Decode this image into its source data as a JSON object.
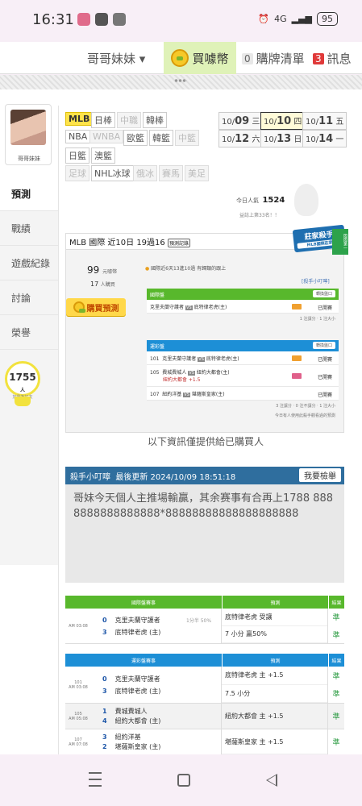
{
  "status_bar": {
    "time": "16:31",
    "network": "4G",
    "battery": "95"
  },
  "top_nav": {
    "user": "哥哥妹妹 ▾",
    "buy_label": "買噱幣",
    "cart_count": "0",
    "cart_label": "購牌清單",
    "msg_count": "3",
    "msg_label": "訊息"
  },
  "profile": {
    "name": "哥哥妹妹"
  },
  "sidebar": {
    "items": [
      {
        "label": "預測"
      },
      {
        "label": "戰績"
      },
      {
        "label": "遊戲紀錄"
      },
      {
        "label": "討論"
      },
      {
        "label": "榮譽"
      }
    ]
  },
  "hearts": {
    "count": "1755",
    "unit": "人",
    "sub": "加我為好友"
  },
  "sports": [
    {
      "label": "MLB"
    },
    {
      "label": "日棒"
    },
    {
      "label": "中職"
    },
    {
      "label": "韓棒"
    },
    {
      "label": "NBA"
    },
    {
      "label": "WNBA"
    },
    {
      "label": "歐籃"
    },
    {
      "label": "韓籃"
    },
    {
      "label": "中籃"
    },
    {
      "label": "日籃"
    },
    {
      "label": "澳籃"
    },
    {
      "label": "足球"
    },
    {
      "label": "NHL冰球"
    },
    {
      "label": "俄冰"
    },
    {
      "label": "賽馬"
    },
    {
      "label": "美足"
    }
  ],
  "dates": [
    {
      "prefix": "10/",
      "day": "09",
      "weekday": "三"
    },
    {
      "prefix": "10/",
      "day": "10",
      "weekday": "四"
    },
    {
      "prefix": "10/",
      "day": "11",
      "weekday": "五"
    },
    {
      "prefix": "10/",
      "day": "12",
      "weekday": "六"
    },
    {
      "prefix": "10/",
      "day": "13",
      "weekday": "日"
    },
    {
      "prefix": "10/",
      "day": "14",
      "weekday": "一"
    }
  ],
  "stats": {
    "today_label": "今日人氣",
    "today_value": "1524",
    "rank": "益誌上第33名！！"
  },
  "panel": {
    "title": "MLB 國際 近10日 19過16",
    "title_badge": "預測記錄",
    "king_badge": "莊家殺手",
    "king_sub": "MLB國際莊家",
    "ribbon": "悶悶第一",
    "price": "99",
    "price_unit": "元噱幣",
    "buyers": "17",
    "buyers_unit": "人購買",
    "buy_button": "購買預測",
    "note": "國際近6天13進10過 有歸類的跟上",
    "link": "[殺手小叮嚀]",
    "international": {
      "header": "國際盤",
      "btn": "轉換盤口",
      "rows": [
        {
          "home": "克里夫蘭守護者",
          "vs": "VS",
          "away": "底特律老虎(主)",
          "status": "已開賽"
        }
      ],
      "foot": "1 注讓分 ‧ 1 注大小"
    },
    "taiwan": {
      "header": "運彩盤",
      "btn": "轉換盤口",
      "rows": [
        {
          "num": "101",
          "home": "克里夫蘭守護者",
          "vs": "VS",
          "away": "底特律老虎(主)",
          "status": "已開賽",
          "line": ""
        },
        {
          "num": "105",
          "home": "費城費城人",
          "vs": "VS",
          "away": "紐約大都會(主)",
          "status": "已開賽",
          "line": "紐約大都會 +1.5"
        },
        {
          "num": "107",
          "home": "紐約洋基",
          "vs": "VS",
          "away": "堪薩斯皇家(主)",
          "status": "已開賽",
          "line": ""
        }
      ],
      "foot": "3 注讓分 ‧ 0 注不讓分 ‧ 1 注大小",
      "foot2": "今日有人使用此殺手觀看過的預測"
    }
  },
  "info_text": "以下資訊僅提供給已購買人",
  "tip": {
    "title": "殺手小叮嚀",
    "updated": "最後更新 2024/10/09 18:51:18",
    "report_btn": "我要檢舉",
    "body": "哥妹今天個人主推場輸贏，其余赛事有合再上1788 8888888888888888*88888888888888888888"
  },
  "intl_table": {
    "headers": [
      "國際盤賽事",
      "預測",
      "結果"
    ],
    "rows": [
      {
        "time": "AM 03:08",
        "team1_num": "0",
        "team1": "克里夫蘭守護者",
        "team2_num": "3",
        "team2": "底特律老虎 (主)",
        "spread": "1分半 50%",
        "pred1": "底特律老虎 受讓",
        "pred2": "7 小分 贏50%",
        "res1": "準",
        "res2": "準"
      }
    ]
  },
  "tw_table": {
    "headers": [
      "運彩盤賽事",
      "預測",
      "結果"
    ],
    "rows": [
      {
        "num": "101",
        "time": "AM 03:08",
        "team1_num": "0",
        "team1": "克里夫蘭守護者",
        "team2_num": "3",
        "team2": "底特律老虎 (主)",
        "pred1": "底特律老虎 主 +1.5",
        "pred2": "7.5 小分",
        "res1": "準",
        "res2": "準"
      },
      {
        "num": "105",
        "time": "AM 05:08",
        "team1_num": "1",
        "team1": "費城費城人",
        "team2_num": "4",
        "team2": "紐約大都會 (主)",
        "pred1": "紐約大都會 主 +1.5",
        "pred2": "",
        "res1": "準",
        "res2": ""
      },
      {
        "num": "107",
        "time": "AM 07:08",
        "team1_num": "3",
        "team1": "紐約洋基",
        "team2_num": "2",
        "team2": "堪薩斯皇家 (主)",
        "pred1": "堪薩斯皇家 主 +1.5",
        "pred2": "",
        "res1": "準",
        "res2": ""
      }
    ]
  },
  "colors": {
    "green": "#58b82c",
    "blue": "#1d8fd6",
    "tip_blue": "#2f6e9e",
    "yellow": "#ffe34a"
  }
}
